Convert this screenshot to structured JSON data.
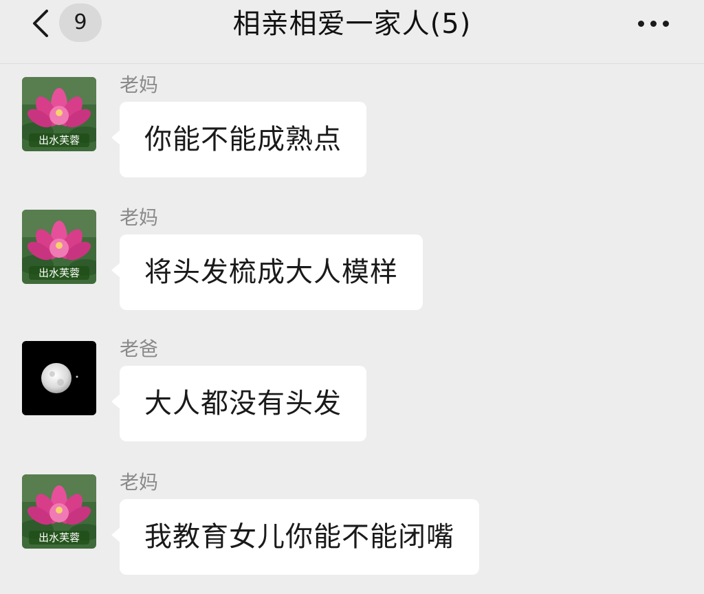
{
  "header": {
    "back_icon": "chevron-left-icon",
    "unread_count": "9",
    "title": "相亲相爱一家人(5)",
    "more_icon": "more-dots-icon"
  },
  "avatars": {
    "lotus": {
      "type": "pink lotus flower image",
      "caption": "出水芙蓉"
    },
    "moon": {
      "type": "full moon on black image"
    }
  },
  "messages": [
    {
      "sender": "老妈",
      "avatar": "lotus",
      "text": "你能不能成熟点"
    },
    {
      "sender": "老妈",
      "avatar": "lotus",
      "text": "将头发梳成大人模样"
    },
    {
      "sender": "老爸",
      "avatar": "moon",
      "text": "大人都没有头发"
    },
    {
      "sender": "老妈",
      "avatar": "lotus",
      "text": "我教育女儿你能不能闭嘴"
    }
  ],
  "colors": {
    "background": "#ededed",
    "bubble": "#ffffff",
    "sender_name": "#8a8a8a",
    "caption_green": "#2e6b1f"
  }
}
